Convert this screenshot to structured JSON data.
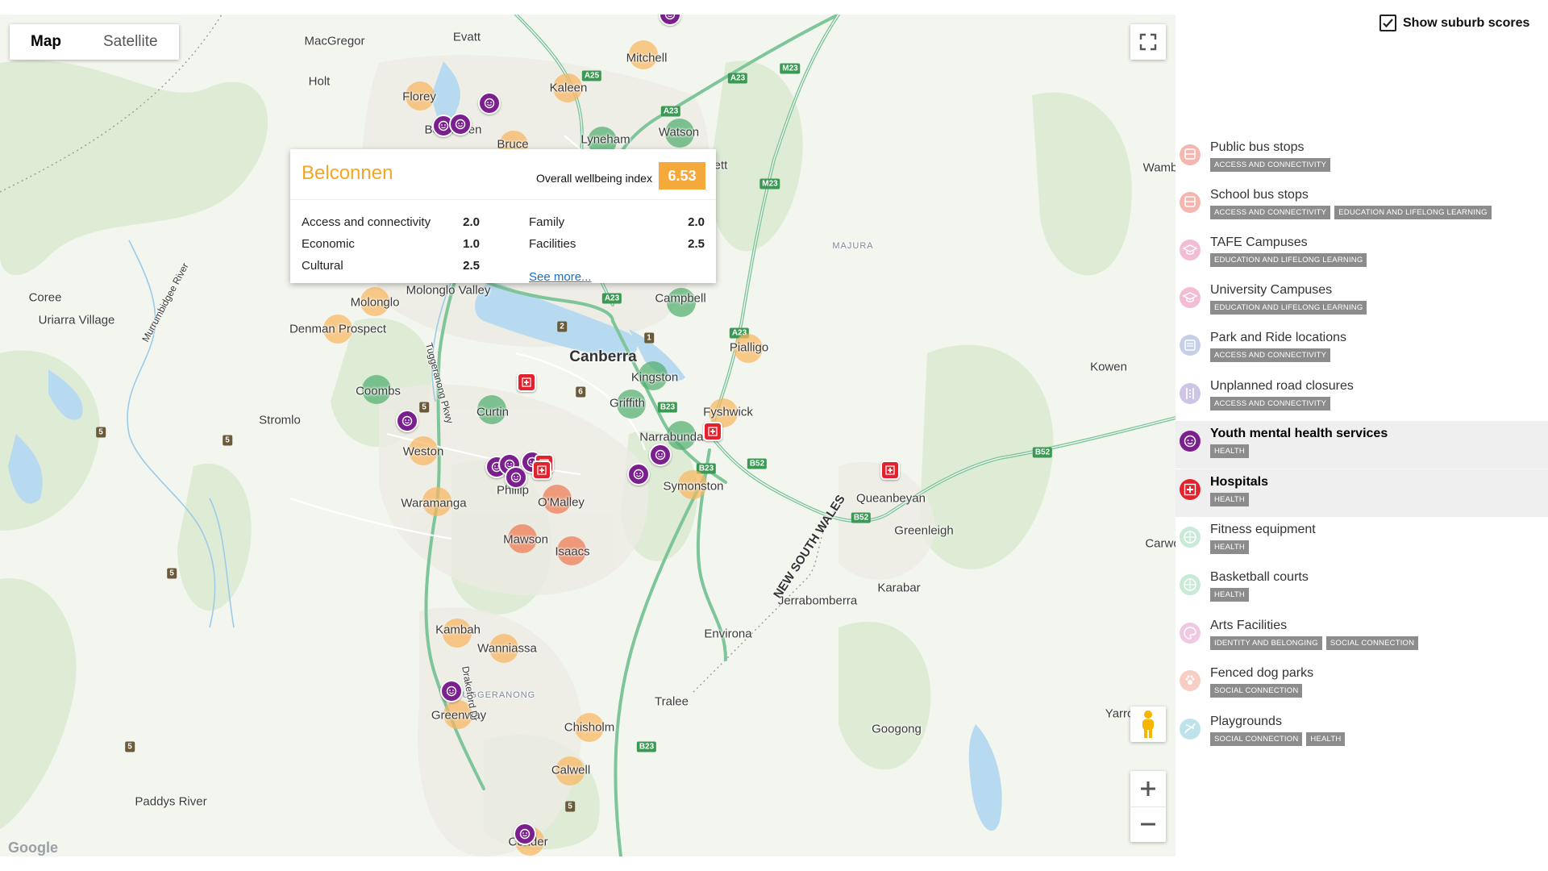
{
  "map_type": {
    "map": "Map",
    "satellite": "Satellite",
    "selected": "Map"
  },
  "attribution": "Google",
  "places": [
    {
      "name": "MacGregor"
    },
    {
      "name": "Evatt"
    },
    {
      "name": "Mitchell"
    },
    {
      "name": "Holt"
    },
    {
      "name": "Florey"
    },
    {
      "name": "Kaleen"
    },
    {
      "name": "Watson"
    },
    {
      "name": "Lyneham"
    },
    {
      "name": "Bruce"
    },
    {
      "name": "Belconnen"
    },
    {
      "name": "ett"
    },
    {
      "name": "Wamb"
    },
    {
      "name": "MAJURA"
    },
    {
      "name": "Coree"
    },
    {
      "name": "Uriarra Village"
    },
    {
      "name": "Molonglo"
    },
    {
      "name": "Molonglo Valley"
    },
    {
      "name": "Campbell"
    },
    {
      "name": "Denman Prospect"
    },
    {
      "name": "Canberra"
    },
    {
      "name": "Pialligo"
    },
    {
      "name": "Kingston"
    },
    {
      "name": "Coombs"
    },
    {
      "name": "Curtin"
    },
    {
      "name": "Griffith"
    },
    {
      "name": "Fyshwick"
    },
    {
      "name": "Stromlo"
    },
    {
      "name": "Narrabundah"
    },
    {
      "name": "Weston"
    },
    {
      "name": "Kowen"
    },
    {
      "name": "Phillip"
    },
    {
      "name": "Symonston"
    },
    {
      "name": "Waramanga"
    },
    {
      "name": "O'Malley"
    },
    {
      "name": "Queanbeyan"
    },
    {
      "name": "Greenleigh"
    },
    {
      "name": "NEW SOUTH WALES"
    },
    {
      "name": "Mawson"
    },
    {
      "name": "Isaacs"
    },
    {
      "name": "Carwo"
    },
    {
      "name": "Karabar"
    },
    {
      "name": "Jerrabomberra"
    },
    {
      "name": "Environa"
    },
    {
      "name": "Kambah"
    },
    {
      "name": "Wanniassa"
    },
    {
      "name": "Tralee"
    },
    {
      "name": "Greenway"
    },
    {
      "name": "Yarrow"
    },
    {
      "name": "TUGGERANONG"
    },
    {
      "name": "Chisholm"
    },
    {
      "name": "Googong"
    },
    {
      "name": "Calwell"
    },
    {
      "name": "Paddys River"
    },
    {
      "name": "Conder"
    },
    {
      "name": "Murrumbidgee River"
    },
    {
      "name": "Tuggeranong Pkwy"
    },
    {
      "name": "Drakeford Dr"
    }
  ],
  "road_shields": [
    "A25",
    "A23",
    "M23",
    "A23",
    "M23",
    "A23",
    "A23",
    "B23",
    "B52",
    "B52",
    "B23",
    "B52",
    "B23",
    "2",
    "6",
    "1",
    "5",
    "5",
    "5",
    "5",
    "5",
    "5"
  ],
  "info_window": {
    "suburb": "Belconnen",
    "overall_label": "Overall wellbeing index",
    "overall_value": "6.53",
    "scores": [
      {
        "label": "Access and connectivity",
        "value": "2.0"
      },
      {
        "label": "Economic",
        "value": "1.0"
      },
      {
        "label": "Cultural",
        "value": "2.5"
      },
      {
        "label": "Family",
        "value": "2.0"
      },
      {
        "label": "Facilities",
        "value": "2.5"
      }
    ],
    "see_more": "See more..."
  },
  "panel": {
    "show_scores_label": "Show suburb scores",
    "show_scores_checked": true,
    "layers": [
      {
        "title": "Public bus stops",
        "icon": "bus-icon",
        "color": "#f6b6b0",
        "active": false,
        "tags": [
          "ACCESS AND CONNECTIVITY"
        ]
      },
      {
        "title": "School bus stops",
        "icon": "school-bus-icon",
        "color": "#f6b6b0",
        "active": false,
        "tags": [
          "ACCESS AND CONNECTIVITY",
          "EDUCATION AND LIFELONG LEARNING"
        ]
      },
      {
        "title": "TAFE Campuses",
        "icon": "graduation-cap-icon",
        "color": "#f2bcd4",
        "active": false,
        "tags": [
          "EDUCATION AND LIFELONG LEARNING"
        ]
      },
      {
        "title": "University Campuses",
        "icon": "graduation-cap-icon",
        "color": "#f2bcd4",
        "active": false,
        "tags": [
          "EDUCATION AND LIFELONG LEARNING"
        ]
      },
      {
        "title": "Park and Ride locations",
        "icon": "park-ride-icon",
        "color": "#c5cfe8",
        "active": false,
        "tags": [
          "ACCESS AND CONNECTIVITY"
        ]
      },
      {
        "title": "Unplanned road closures",
        "icon": "road-closure-icon",
        "color": "#cdc4e6",
        "active": false,
        "tags": [
          "ACCESS AND CONNECTIVITY"
        ]
      },
      {
        "title": "Youth mental health services",
        "icon": "mental-health-icon",
        "color": "#7b1f8f",
        "active": true,
        "tags": [
          "HEALTH"
        ]
      },
      {
        "title": "Hospitals",
        "icon": "hospital-icon",
        "color": "#e3222d",
        "active": true,
        "tags": [
          "HEALTH"
        ]
      },
      {
        "title": "Fitness equipment",
        "icon": "fitness-icon",
        "color": "#c8ead7",
        "active": false,
        "tags": [
          "HEALTH"
        ]
      },
      {
        "title": "Basketball courts",
        "icon": "basketball-icon",
        "color": "#c8ead7",
        "active": false,
        "tags": [
          "HEALTH"
        ]
      },
      {
        "title": "Arts Facilities",
        "icon": "palette-icon",
        "color": "#efc8e3",
        "active": false,
        "tags": [
          "IDENTITY AND BELONGING",
          "SOCIAL CONNECTION"
        ]
      },
      {
        "title": "Fenced dog parks",
        "icon": "dog-icon",
        "color": "#f8cdc4",
        "active": false,
        "tags": [
          "SOCIAL CONNECTION"
        ]
      },
      {
        "title": "Playgrounds",
        "icon": "playground-icon",
        "color": "#bfe3ea",
        "active": false,
        "tags": [
          "SOCIAL CONNECTION",
          "HEALTH"
        ]
      }
    ]
  },
  "colors": {
    "score_high": "#50af6e",
    "score_mid": "#fab660",
    "score_low": "#ef7850",
    "youth_mental_health": "#7b1f8f",
    "hospital": "#e3222d",
    "index_badge": "#f6a93b"
  }
}
